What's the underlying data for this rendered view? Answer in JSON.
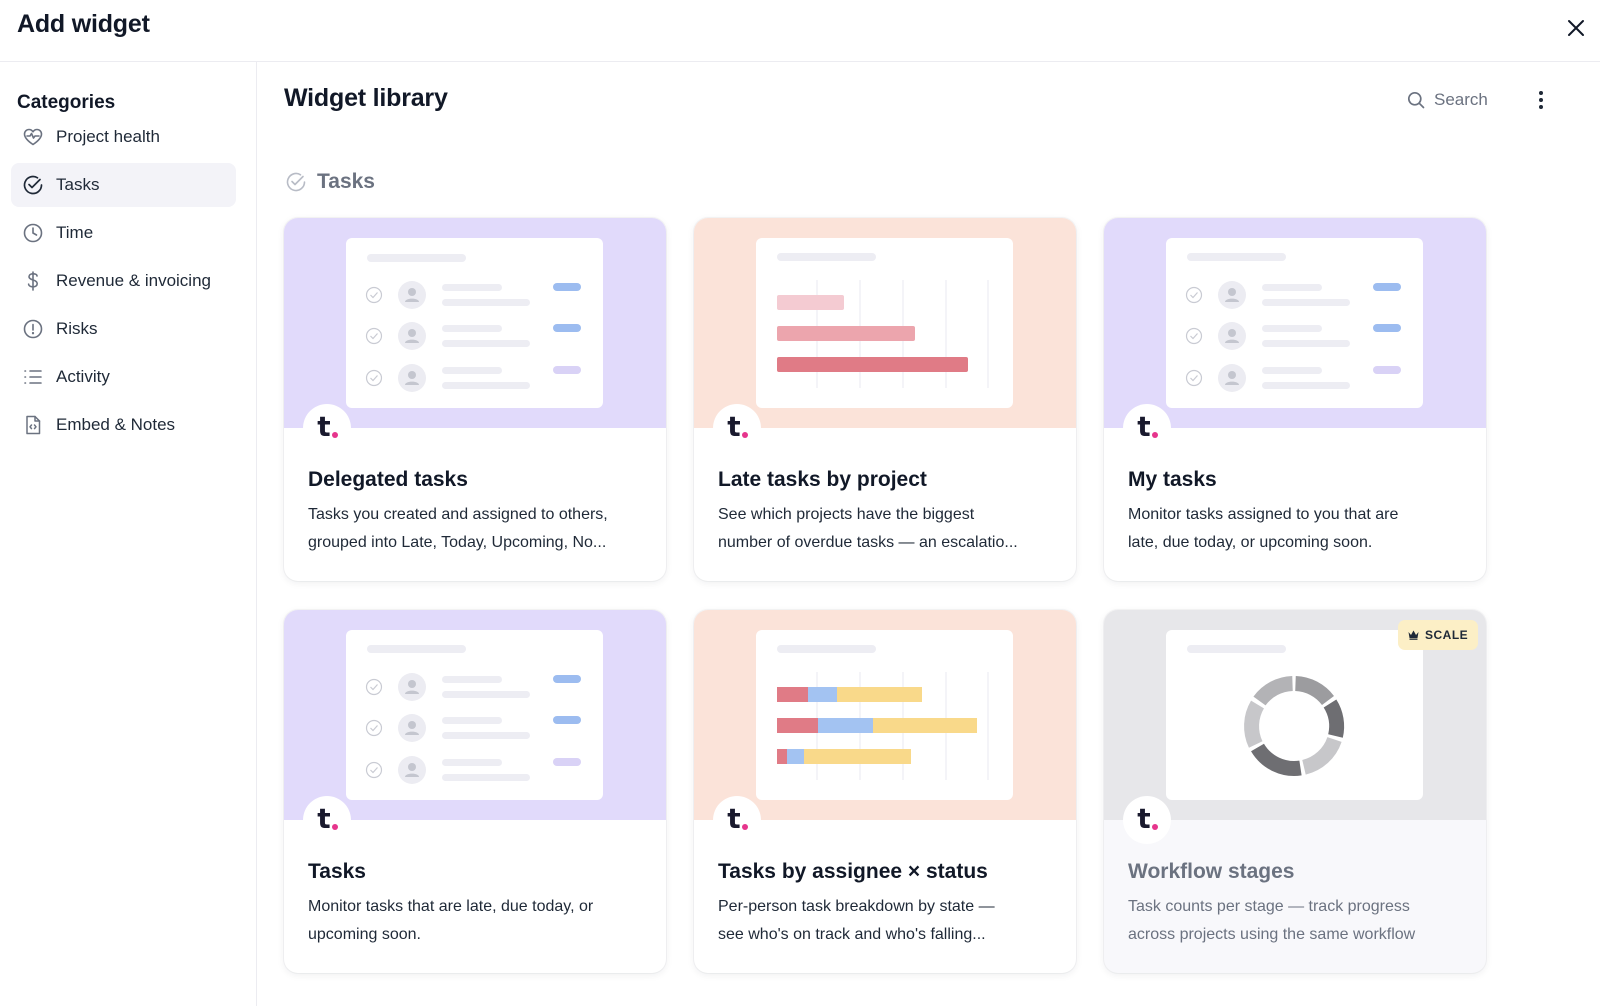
{
  "modal": {
    "title": "Add widget"
  },
  "sidebar": {
    "heading": "Categories",
    "items": [
      {
        "label": "Project health",
        "icon": "heart-pulse-icon"
      },
      {
        "label": "Tasks",
        "icon": "check-circle-icon",
        "active": true
      },
      {
        "label": "Time",
        "icon": "clock-icon"
      },
      {
        "label": "Revenue & invoicing",
        "icon": "dollar-icon"
      },
      {
        "label": "Risks",
        "icon": "alert-circle-icon"
      },
      {
        "label": "Activity",
        "icon": "list-icon"
      },
      {
        "label": "Embed & Notes",
        "icon": "code-file-icon"
      }
    ]
  },
  "main": {
    "title": "Widget library",
    "search_label": "Search",
    "section": {
      "label": "Tasks"
    },
    "cards": [
      {
        "title": "Delegated tasks",
        "desc1": "Tasks you created and assigned to others,",
        "desc2": "grouped into Late, Today, Upcoming, No...",
        "preview": "task-list"
      },
      {
        "title": "Late tasks by project",
        "desc1": "See which projects have the biggest",
        "desc2": "number of overdue tasks — an escalatio...",
        "preview": "bar-chart"
      },
      {
        "title": "My tasks",
        "desc1": "Monitor tasks assigned to you that are",
        "desc2": "late, due today, or upcoming soon.",
        "preview": "task-list"
      },
      {
        "title": "Tasks",
        "desc1": "Monitor tasks that are late, due today, or",
        "desc2": "upcoming soon.",
        "preview": "task-list"
      },
      {
        "title": "Tasks by assignee × status",
        "desc1": "Per-person task breakdown by state —",
        "desc2": "see who's on track and who's falling...",
        "preview": "stacked-bar-chart"
      },
      {
        "title": "Workflow stages",
        "desc1": "Task counts per stage — track progress",
        "desc2": "across projects using the same workflow",
        "preview": "donut-chart",
        "badge": "SCALE"
      }
    ]
  },
  "colors": {
    "lilac": "#e1dafb",
    "peach": "#fbe3d9",
    "gray": "#e7e7ea",
    "brand_dot": "#e6358c",
    "late_red": "#e07b86",
    "blue": "#a3c3f2",
    "yellow": "#f9d98a"
  }
}
